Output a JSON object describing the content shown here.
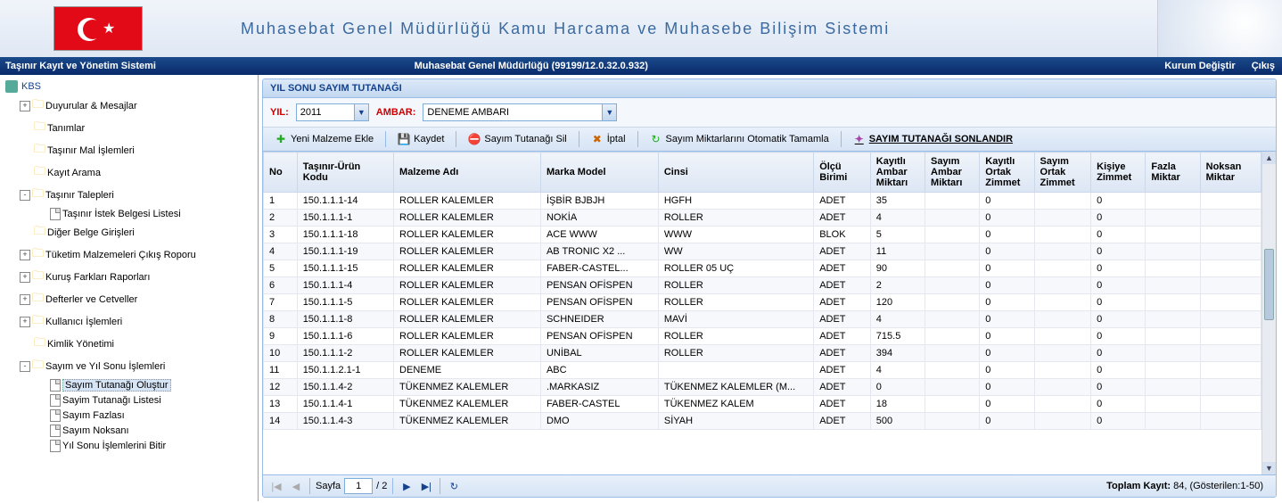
{
  "header": {
    "title": "Muhasebat Genel Müdürlüğü Kamu Harcama ve Muhasebe Bilişim Sistemi"
  },
  "topbar": {
    "left": "Taşınır Kayıt ve Yönetim Sistemi",
    "center": "Muhasebat Genel Müdürlüğü (99199/12.0.32.0.932)",
    "kurum": "Kurum Değiştir",
    "cikis": "Çıkış"
  },
  "sidebar": {
    "root": "KBS",
    "items": [
      {
        "label": "Duyurular & Mesajlar",
        "exp": "+",
        "folder": true
      },
      {
        "label": "Tanımlar",
        "exp": "",
        "folder": true
      },
      {
        "label": "Taşınır Mal İşlemleri",
        "exp": "",
        "folder": true
      },
      {
        "label": "Kayıt Arama",
        "exp": "",
        "folder": true
      },
      {
        "label": "Taşınır Talepleri",
        "exp": "-",
        "folder": true
      },
      {
        "label": "Taşınır İstek Belgesi Listesi",
        "exp": "",
        "folder": false,
        "indent": 2
      },
      {
        "label": "Diğer Belge Girişleri",
        "exp": "",
        "folder": true
      },
      {
        "label": "Tüketim Malzemeleri Çıkış Roporu",
        "exp": "+",
        "folder": true
      },
      {
        "label": "Kuruş Farkları Raporları",
        "exp": "+",
        "folder": true
      },
      {
        "label": "Defterler ve Cetveller",
        "exp": "+",
        "folder": true
      },
      {
        "label": "Kullanıcı İşlemleri",
        "exp": "+",
        "folder": true
      },
      {
        "label": "Kimlik Yönetimi",
        "exp": "",
        "folder": true
      },
      {
        "label": "Sayım ve Yıl Sonu İşlemleri",
        "exp": "-",
        "folder": true
      },
      {
        "label": "Sayım Tutanağı Oluştur",
        "exp": "",
        "folder": false,
        "indent": 2,
        "selected": true
      },
      {
        "label": "Sayim Tutanağı Listesi",
        "exp": "",
        "folder": false,
        "indent": 2
      },
      {
        "label": "Sayım Fazlası",
        "exp": "",
        "folder": false,
        "indent": 2
      },
      {
        "label": "Sayım Noksanı",
        "exp": "",
        "folder": false,
        "indent": 2
      },
      {
        "label": "Yıl Sonu İşlemlerini Bitir",
        "exp": "",
        "folder": false,
        "indent": 2
      }
    ]
  },
  "panel": {
    "title": "YIL SONU SAYIM TUTANAĞI"
  },
  "filter": {
    "yil_label": "YIL:",
    "yil_value": "2011",
    "ambar_label": "AMBAR:",
    "ambar_value": "DENEME AMBARI"
  },
  "toolbar": {
    "add": "Yeni Malzeme Ekle",
    "save": "Kaydet",
    "delete": "Sayım Tutanağı Sil",
    "cancel": "İptal",
    "auto": "Sayım Miktarlarını Otomatik Tamamla",
    "final": "SAYIM TUTANAĞI SONLANDIR"
  },
  "grid": {
    "headers": {
      "no": "No",
      "kod": "Taşınır-Ürün Kodu",
      "mal": "Malzeme Adı",
      "mar": "Marka Model",
      "cin": "Cinsi",
      "olb": "Ölçü Birimi",
      "kam": "Kayıtlı Ambar Miktarı",
      "sam": "Sayım Ambar Miktarı",
      "koz": "Kayıtlı Ortak Zimmet",
      "soz": "Sayım Ortak Zimmet",
      "kz": "Kişiye Zimmet",
      "fm": "Fazla Miktar",
      "nm": "Noksan Miktar"
    },
    "rows": [
      {
        "no": "1",
        "kod": "150.1.1.1-14",
        "mal": "ROLLER KALEMLER",
        "mar": "İŞBİR BJBJH",
        "cin": "HGFH",
        "olb": "ADET",
        "kam": "35",
        "sam": "",
        "koz": "0",
        "soz": "",
        "kz": "0",
        "fm": "",
        "nm": ""
      },
      {
        "no": "2",
        "kod": "150.1.1.1-1",
        "mal": "ROLLER KALEMLER",
        "mar": "NOKİA",
        "cin": "ROLLER",
        "olb": "ADET",
        "kam": "4",
        "sam": "",
        "koz": "0",
        "soz": "",
        "kz": "0",
        "fm": "",
        "nm": ""
      },
      {
        "no": "3",
        "kod": "150.1.1.1-18",
        "mal": "ROLLER KALEMLER",
        "mar": "ACE WWW",
        "cin": "WWW",
        "olb": "BLOK",
        "kam": "5",
        "sam": "",
        "koz": "0",
        "soz": "",
        "kz": "0",
        "fm": "",
        "nm": ""
      },
      {
        "no": "4",
        "kod": "150.1.1.1-19",
        "mal": "ROLLER KALEMLER",
        "mar": "AB TRONIC X2 ...",
        "cin": "WW",
        "olb": "ADET",
        "kam": "11",
        "sam": "",
        "koz": "0",
        "soz": "",
        "kz": "0",
        "fm": "",
        "nm": ""
      },
      {
        "no": "5",
        "kod": "150.1.1.1-15",
        "mal": "ROLLER KALEMLER",
        "mar": "FABER-CASTEL...",
        "cin": "ROLLER 05 UÇ",
        "olb": "ADET",
        "kam": "90",
        "sam": "",
        "koz": "0",
        "soz": "",
        "kz": "0",
        "fm": "",
        "nm": ""
      },
      {
        "no": "6",
        "kod": "150.1.1.1-4",
        "mal": "ROLLER KALEMLER",
        "mar": "PENSAN OFİSPEN",
        "cin": "ROLLER",
        "olb": "ADET",
        "kam": "2",
        "sam": "",
        "koz": "0",
        "soz": "",
        "kz": "0",
        "fm": "",
        "nm": ""
      },
      {
        "no": "7",
        "kod": "150.1.1.1-5",
        "mal": "ROLLER KALEMLER",
        "mar": "PENSAN OFİSPEN",
        "cin": "ROLLER",
        "olb": "ADET",
        "kam": "120",
        "sam": "",
        "koz": "0",
        "soz": "",
        "kz": "0",
        "fm": "",
        "nm": ""
      },
      {
        "no": "8",
        "kod": "150.1.1.1-8",
        "mal": "ROLLER KALEMLER",
        "mar": "SCHNEIDER",
        "cin": "MAVİ",
        "olb": "ADET",
        "kam": "4",
        "sam": "",
        "koz": "0",
        "soz": "",
        "kz": "0",
        "fm": "",
        "nm": ""
      },
      {
        "no": "9",
        "kod": "150.1.1.1-6",
        "mal": "ROLLER KALEMLER",
        "mar": "PENSAN OFİSPEN",
        "cin": "ROLLER",
        "olb": "ADET",
        "kam": "715.5",
        "sam": "",
        "koz": "0",
        "soz": "",
        "kz": "0",
        "fm": "",
        "nm": ""
      },
      {
        "no": "10",
        "kod": "150.1.1.1-2",
        "mal": "ROLLER KALEMLER",
        "mar": "UNİBAL",
        "cin": "ROLLER",
        "olb": "ADET",
        "kam": "394",
        "sam": "",
        "koz": "0",
        "soz": "",
        "kz": "0",
        "fm": "",
        "nm": ""
      },
      {
        "no": "11",
        "kod": "150.1.1.2.1-1",
        "mal": "DENEME",
        "mar": "ABC",
        "cin": "",
        "olb": "ADET",
        "kam": "4",
        "sam": "",
        "koz": "0",
        "soz": "",
        "kz": "0",
        "fm": "",
        "nm": ""
      },
      {
        "no": "12",
        "kod": "150.1.1.4-2",
        "mal": "TÜKENMEZ KALEMLER",
        "mar": ".MARKASIZ",
        "cin": "TÜKENMEZ KALEMLER (M...",
        "olb": "ADET",
        "kam": "0",
        "sam": "",
        "koz": "0",
        "soz": "",
        "kz": "0",
        "fm": "",
        "nm": ""
      },
      {
        "no": "13",
        "kod": "150.1.1.4-1",
        "mal": "TÜKENMEZ KALEMLER",
        "mar": "FABER-CASTEL",
        "cin": "TÜKENMEZ KALEM",
        "olb": "ADET",
        "kam": "18",
        "sam": "",
        "koz": "0",
        "soz": "",
        "kz": "0",
        "fm": "",
        "nm": ""
      },
      {
        "no": "14",
        "kod": "150.1.1.4-3",
        "mal": "TÜKENMEZ KALEMLER",
        "mar": "DMO",
        "cin": "SİYAH",
        "olb": "ADET",
        "kam": "500",
        "sam": "",
        "koz": "0",
        "soz": "",
        "kz": "0",
        "fm": "",
        "nm": ""
      }
    ]
  },
  "pager": {
    "label": "Sayfa",
    "cur": "1",
    "sep": "/ 2",
    "info_label": "Toplam Kayıt:",
    "info_value": " 84, (Gösterilen:1-50)"
  }
}
